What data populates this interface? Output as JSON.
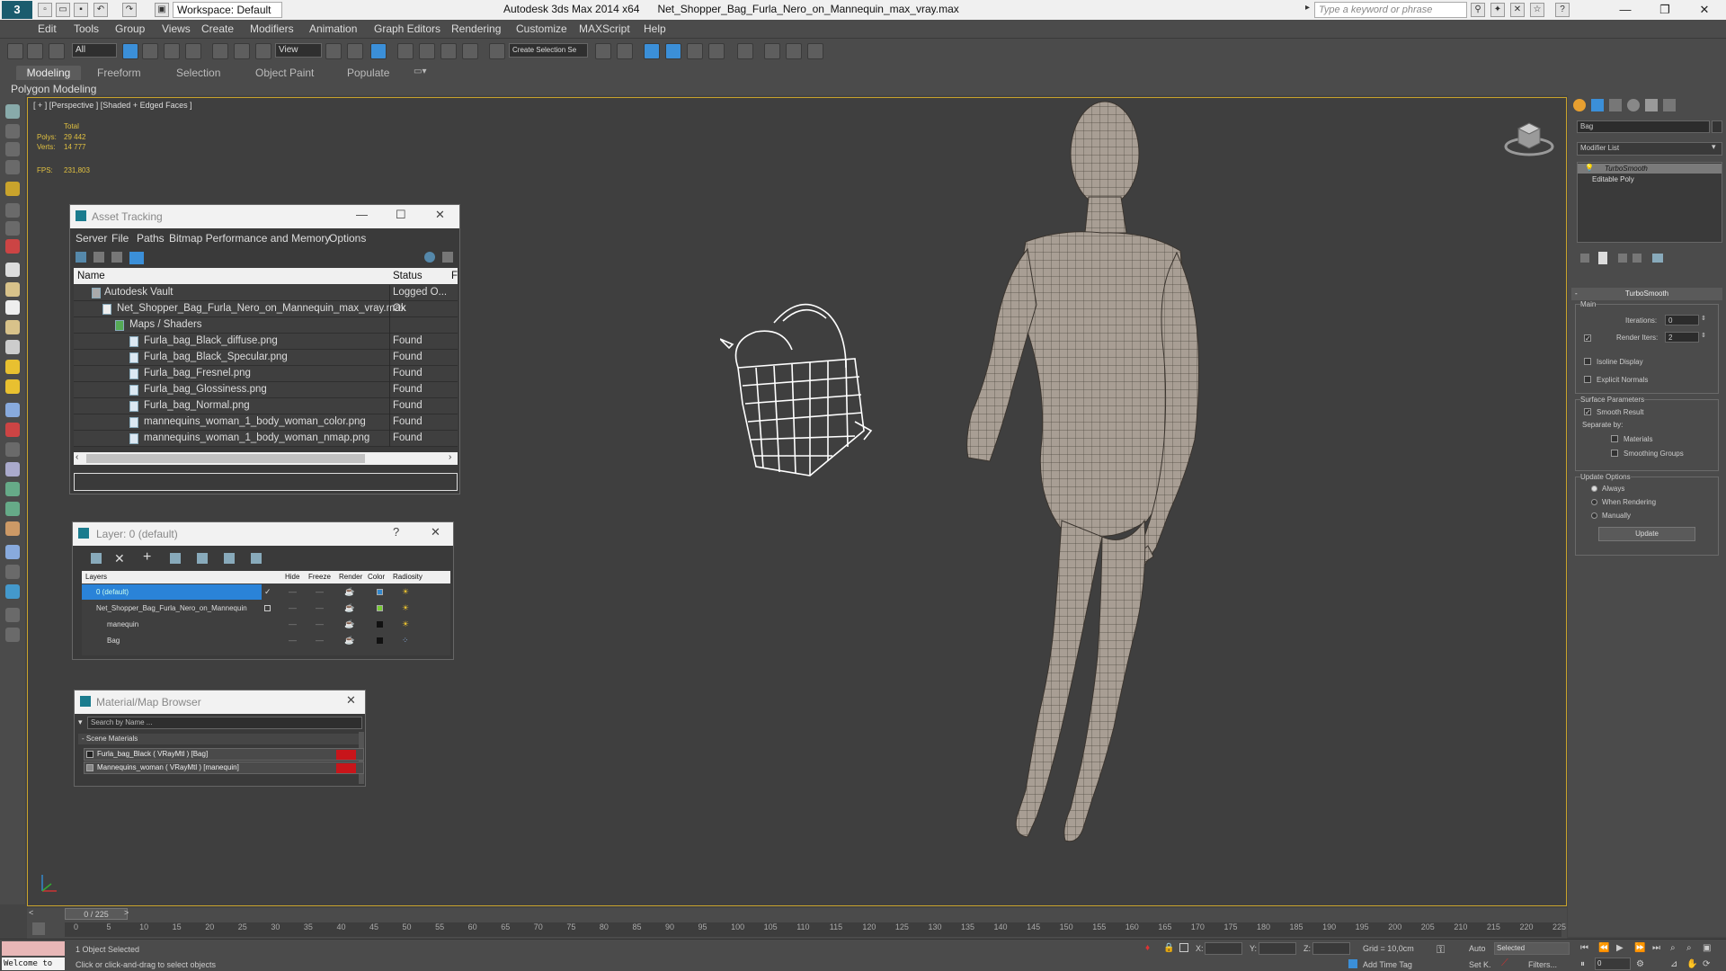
{
  "titlebar": {
    "workspace": "Workspace: Default",
    "app_title": "Autodesk 3ds Max  2014 x64",
    "file_name": "Net_Shopper_Bag_Furla_Nero_on_Mannequin_max_vray.max",
    "search_placeholder": "Type a keyword or phrase"
  },
  "menu": [
    "Edit",
    "Tools",
    "Group",
    "Views",
    "Create",
    "Modifiers",
    "Animation",
    "Graph Editors",
    "Rendering",
    "Customize",
    "MAXScript",
    "Help"
  ],
  "toolbar": {
    "filter": "All",
    "refcoord": "View",
    "selection_set": "Create Selection Se"
  },
  "ribbon": {
    "tabs": [
      "Modeling",
      "Freeform",
      "Selection",
      "Object Paint",
      "Populate"
    ],
    "sub_label": "Polygon Modeling"
  },
  "viewport": {
    "label": "[ + ] [Perspective ] [Shaded + Edged Faces ]",
    "stats": {
      "total": "Total",
      "polys_label": "Polys:",
      "polys": "29 442",
      "verts_label": "Verts:",
      "verts": "14 777",
      "fps_label": "FPS:",
      "fps": "231,803"
    }
  },
  "asset_tracking": {
    "title": "Asset Tracking",
    "menu": [
      "Server",
      "File",
      "Paths",
      "Bitmap Performance and Memory",
      "Options"
    ],
    "col_name": "Name",
    "col_status": "Status",
    "col_path": "F",
    "rows": [
      {
        "name": "Autodesk Vault",
        "status": "Logged O..."
      },
      {
        "name": "Net_Shopper_Bag_Furla_Nero_on_Mannequin_max_vray.max",
        "status": "Ok"
      },
      {
        "name": "Maps / Shaders",
        "status": ""
      },
      {
        "name": "Furla_bag_Black_diffuse.png",
        "status": "Found"
      },
      {
        "name": "Furla_bag_Black_Specular.png",
        "status": "Found"
      },
      {
        "name": "Furla_bag_Fresnel.png",
        "status": "Found"
      },
      {
        "name": "Furla_bag_Glossiness.png",
        "status": "Found"
      },
      {
        "name": "Furla_bag_Normal.png",
        "status": "Found"
      },
      {
        "name": "mannequins_woman_1_body_woman_color.png",
        "status": "Found"
      },
      {
        "name": "mannequins_woman_1_body_woman_nmap.png",
        "status": "Found"
      }
    ]
  },
  "layer_manager": {
    "title": "Layer: 0 (default)",
    "columns": [
      "Layers",
      "Hide",
      "Freeze",
      "Render",
      "Color",
      "Radiosity"
    ],
    "rows": [
      {
        "name": "0 (default)"
      },
      {
        "name": "Net_Shopper_Bag_Furla_Nero_on_Mannequin"
      },
      {
        "name": "manequin"
      },
      {
        "name": "Bag"
      }
    ]
  },
  "material_browser": {
    "title": "Material/Map Browser",
    "search_placeholder": "Search by Name ...",
    "group": "- Scene Materials",
    "items": [
      "Furla_bag_Black  ( VRayMtl ) [Bag]",
      "Mannequins_woman  ( VRayMtl ) [manequin]"
    ]
  },
  "command_panel": {
    "name_field": "Bag",
    "modifier_list": "Modifier List",
    "stack": [
      "TurboSmooth",
      "Editable Poly"
    ],
    "rollout_title": "TurboSmooth",
    "main_label": "Main",
    "iterations_label": "Iterations:",
    "iterations": "0",
    "render_iters_label": "Render Iters:",
    "render_iters": "2",
    "isoline": "Isoline Display",
    "explicit_normals": "Explicit Normals",
    "surface_params": "Surface Parameters",
    "smooth_result": "Smooth Result",
    "separate_by": "Separate by:",
    "materials": "Materials",
    "smoothing_groups": "Smoothing Groups",
    "update_options": "Update Options",
    "always": "Always",
    "when_rendering": "When Rendering",
    "manually": "Manually",
    "update_button": "Update"
  },
  "timeline": {
    "frame": "0 / 225",
    "ticks": [
      "0",
      "5",
      "10",
      "15",
      "20",
      "25",
      "30",
      "35",
      "40",
      "45",
      "50",
      "55",
      "60",
      "65",
      "70",
      "75",
      "80",
      "85",
      "90",
      "95",
      "100",
      "105",
      "110",
      "115",
      "120",
      "125",
      "130",
      "135",
      "140",
      "145",
      "150",
      "155",
      "160",
      "165",
      "170",
      "175",
      "180",
      "185",
      "190",
      "195",
      "200",
      "205",
      "210",
      "215",
      "220",
      "225"
    ]
  },
  "status": {
    "welcome": "Welcome to",
    "selected": "1 Object Selected",
    "prompt": "Click or click-and-drag to select objects",
    "x": "X:",
    "y": "Y:",
    "z": "Z:",
    "grid": "Grid = 10,0cm",
    "add_time_tag": "Add Time Tag",
    "auto": "Auto",
    "selected_dd": "Selected",
    "setk": "Set K.",
    "filters": "Filters...",
    "frame_field": "0"
  }
}
